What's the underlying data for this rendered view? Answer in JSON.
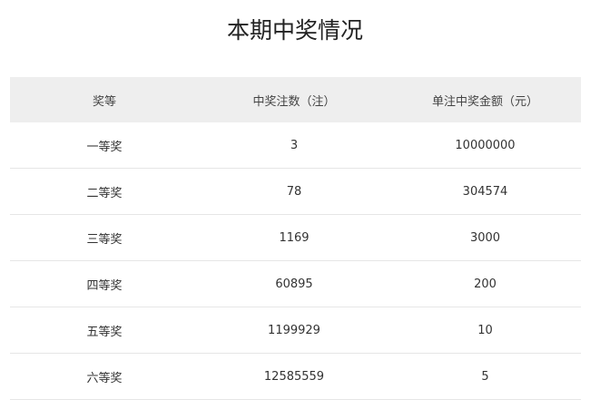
{
  "page": {
    "title": "本期中奖情况"
  },
  "table": {
    "headers": [
      "奖等",
      "中奖注数（注）",
      "单注中奖金额（元）"
    ],
    "rows": [
      {
        "level": "一等奖",
        "count": "3",
        "amount": "10000000"
      },
      {
        "level": "二等奖",
        "count": "78",
        "amount": "304574"
      },
      {
        "level": "三等奖",
        "count": "1169",
        "amount": "3000"
      },
      {
        "level": "四等奖",
        "count": "60895",
        "amount": "200"
      },
      {
        "level": "五等奖",
        "count": "1199929",
        "amount": "10"
      },
      {
        "level": "六等奖",
        "count": "12585559",
        "amount": "5"
      }
    ]
  },
  "colors": {
    "header_bg": "#eeeeee",
    "row_divider": "#e6e6e6",
    "text": "#333333",
    "background": "#ffffff"
  }
}
